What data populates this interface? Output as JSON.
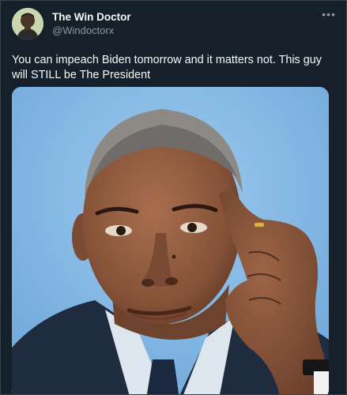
{
  "tweet": {
    "author": {
      "display_name": "The Win Doctor",
      "handle": "@Windoctorx",
      "avatar_icon": "user-avatar"
    },
    "more_icon": "more-options-icon",
    "more_glyph": "•••",
    "text": "You can impeach Biden tomorrow and it matters not. This guy will STILL be The President",
    "media": {
      "type": "photo",
      "background_color": "#83b8e4"
    }
  },
  "theme": {
    "background": "#15202b",
    "text": "#f7f9f9",
    "secondary_text": "#8b98a5",
    "border": "#38444d"
  }
}
